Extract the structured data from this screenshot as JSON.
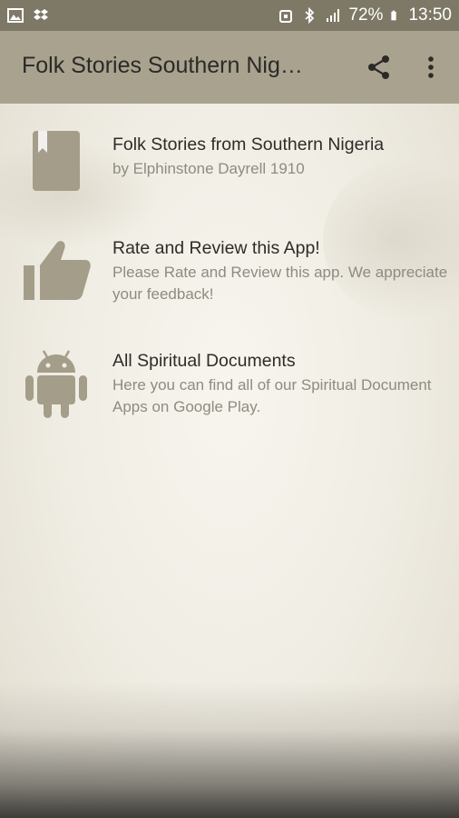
{
  "status_bar": {
    "battery": "72%",
    "time": "13:50"
  },
  "app_bar": {
    "title": "Folk Stories Southern Nig…"
  },
  "items": [
    {
      "title": "Folk Stories from Southern Nigeria",
      "subtitle": "by Elphinstone Dayrell 1910"
    },
    {
      "title": "Rate and Review this App!",
      "subtitle": "Please Rate and Review this app. We appreciate your feedback!"
    },
    {
      "title": "All Spiritual Documents",
      "subtitle": "Here you can find all of our Spiritual Document Apps on Google Play."
    }
  ],
  "colors": {
    "status_bar": "#7e7966",
    "app_bar": "#a8a28f",
    "icon": "#a39d8a"
  }
}
